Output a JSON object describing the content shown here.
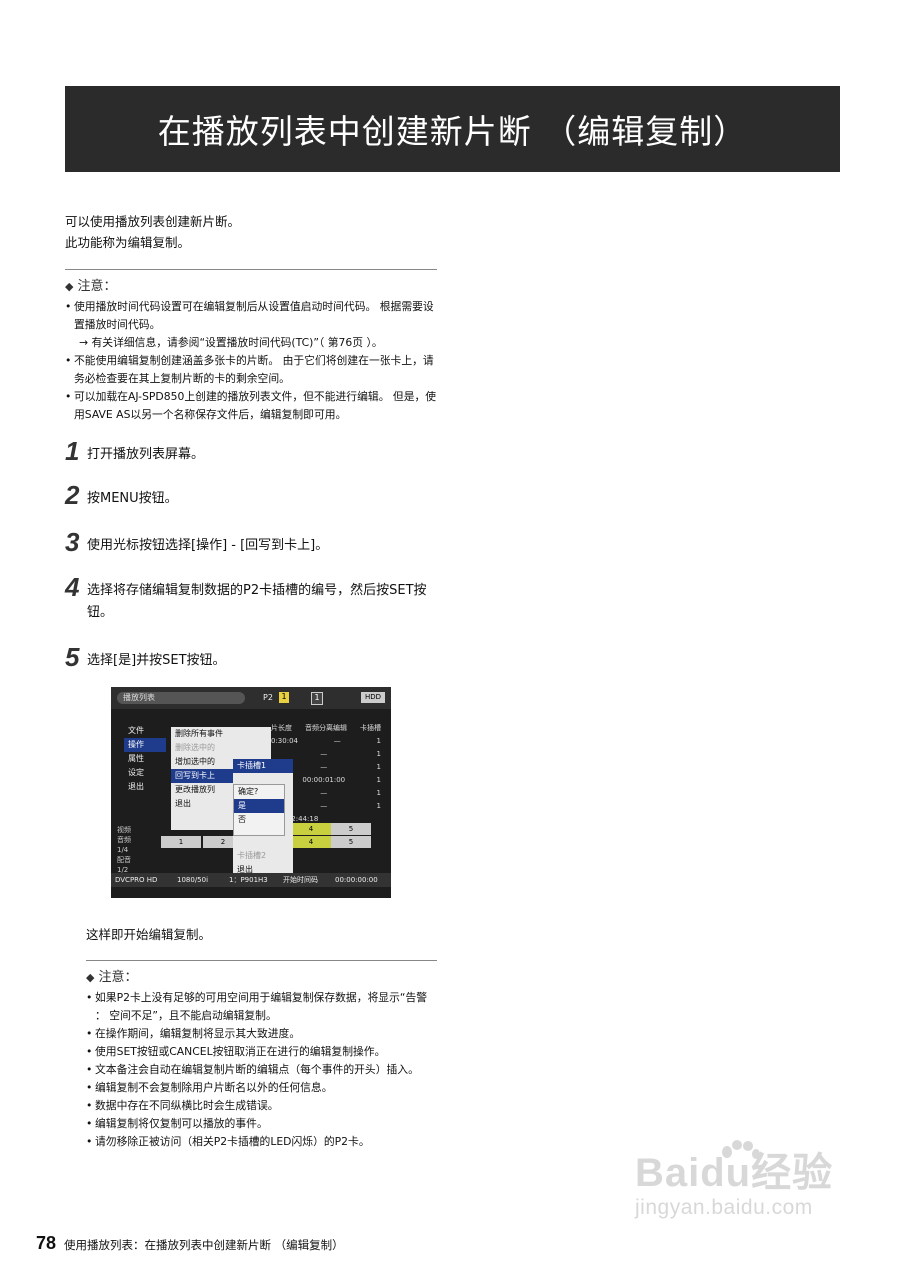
{
  "title": "在播放列表中创建新片断 （编辑复制）",
  "intro": [
    "可以使用播放列表创建新片断。",
    "此功能称为编辑复制。"
  ],
  "note1": {
    "heading": "注意：",
    "items": [
      "使用播放时间代码设置可在编辑复制后从设置值启动时间代码。 根据需要设置播放时间代码。",
      "不能使用编辑复制创建涵盖多张卡的片断。 由于它们将创建在一张卡上，请务必检查要在其上复制片断的卡的剩余空间。",
      "可以加载在AJ-SPD850上创建的播放列表文件，但不能进行编辑。 但是，使用SAVE AS以另一个名称保存文件后，编辑复制即可用。"
    ],
    "ref": "→ 有关详细信息，请参阅“设置播放时间代码(TC)”（ 第76页 ）。"
  },
  "steps": [
    {
      "num": "1",
      "text": "打开播放列表屏幕。"
    },
    {
      "num": "2",
      "text": "按MENU按钮。"
    },
    {
      "num": "3",
      "text": "使用光标按钮选择[操作] - [回写到卡上]。"
    },
    {
      "num": "4",
      "text": "选择将存储编辑复制数据的P2卡插槽的编号，然后按SET按钮。"
    },
    {
      "num": "5",
      "text": "选择[是]并按SET按钮。"
    }
  ],
  "screen": {
    "tab": "播放列表",
    "p2": "P2",
    "slot1": "1",
    "slot2": "1",
    "hdd": "HDD",
    "main_menu": [
      "文件",
      "操作",
      "属性",
      "设定",
      "退出"
    ],
    "sub_menu": [
      "删除所有事件",
      "删除选中的",
      "增加选中的",
      "回写到卡上",
      "更改播放列",
      "退出"
    ],
    "slot_menu": [
      "卡插槽1",
      "卡插槽2",
      "退出"
    ],
    "confirm": [
      "确定?",
      "是",
      "否"
    ],
    "table_rows": [
      [
        "片长度",
        "音频分离编辑",
        "卡插槽"
      ],
      [
        "0:30:04",
        "—",
        "1"
      ],
      [
        "",
        "—",
        "1"
      ],
      [
        "",
        "—",
        "1"
      ],
      [
        "",
        "00:00:01:00",
        "1"
      ],
      [
        "",
        "—",
        "1"
      ],
      [
        "",
        "—",
        "1"
      ],
      [
        "/ 00:02:44:18",
        "",
        ""
      ]
    ],
    "grid": [
      "1",
      "2",
      "4",
      "5",
      "4",
      "5"
    ],
    "left_labels": [
      "视频",
      "音频",
      "1/4",
      "配音",
      "1/2"
    ],
    "bottom": [
      "DVCPRO HD",
      "1080/50i",
      "1：P901H3",
      "开始时间码",
      "00:00:00:00"
    ]
  },
  "result_text": "这样即开始编辑复制。",
  "note2": {
    "heading": "注意：",
    "items": [
      "如果P2卡上没有足够的可用空间用于编辑复制保存数据，将显示“告警 ： 空间不足”，且不能启动编辑复制。",
      "在操作期间，编辑复制将显示其大致进度。",
      "使用SET按钮或CANCEL按钮取消正在进行的编辑复制操作。",
      "文本备注会自动在编辑复制片断的编辑点（每个事件的开头）插入。",
      "编辑复制不会复制除用户片断名以外的任何信息。",
      "数据中存在不同纵横比时会生成错误。",
      "编辑复制将仅复制可以播放的事件。",
      "请勿移除正被访问（相关P2卡插槽的LED闪烁）的P2卡。"
    ]
  },
  "footer": {
    "page": "78",
    "text": "使用播放列表：在播放列表中创建新片断 （编辑复制）"
  },
  "watermark": {
    "logo": "Baidu经验",
    "url": "jingyan.baidu.com"
  }
}
